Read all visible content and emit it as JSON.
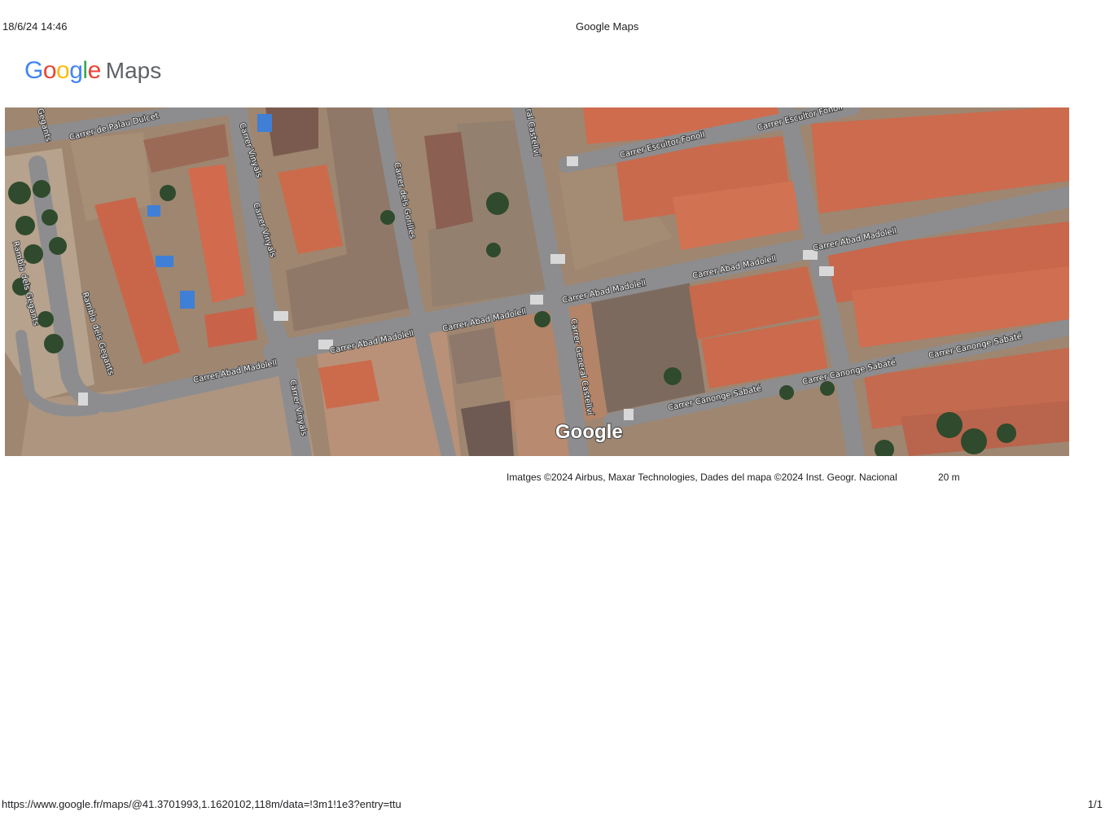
{
  "header": {
    "date": "18/6/24 14:46",
    "title": "Google Maps"
  },
  "logo": {
    "letters": [
      {
        "char": "G",
        "color": "#4285F4"
      },
      {
        "char": "o",
        "color": "#EA4335"
      },
      {
        "char": "o",
        "color": "#FBBC05"
      },
      {
        "char": "g",
        "color": "#4285F4"
      },
      {
        "char": "l",
        "color": "#34A853"
      },
      {
        "char": "e",
        "color": "#EA4335"
      }
    ],
    "product": "Maps"
  },
  "map": {
    "watermark": "Google",
    "street_labels": [
      "Carrer de Palau Dulcet",
      "Carrer Vinyals",
      "Carrer Vinyals",
      "Carrer dels Gorilles",
      "Carrer Escultor Fonoll",
      "Carrer Escultor Fonoll",
      "Carrer Abad Madolell",
      "Carrer Abad Madolell",
      "Carrer Abad Madolell",
      "Carrer Abad Madolell",
      "Carrer Abad Madolell",
      "Carrer Abad Madolell",
      "Rambla dels Gegants",
      "Rambla dels Gegants",
      "Carrer General Castellví",
      "Carrer Canonge Sabaté",
      "Carrer Canonge Sabaté",
      "Carrer Canonge Sabaté",
      "Carrer Vinyals",
      "Gegants",
      "ral Castellví"
    ]
  },
  "attribution": "Imatges ©2024 Airbus, Maxar Technologies, Dades del mapa ©2024 Inst. Geogr. Nacional",
  "scale": "20 m",
  "footer": {
    "url": "https://www.google.fr/maps/@41.3701993,1.1620102,118m/data=!3m1!1e3?entry=ttu",
    "page": "1/1"
  }
}
